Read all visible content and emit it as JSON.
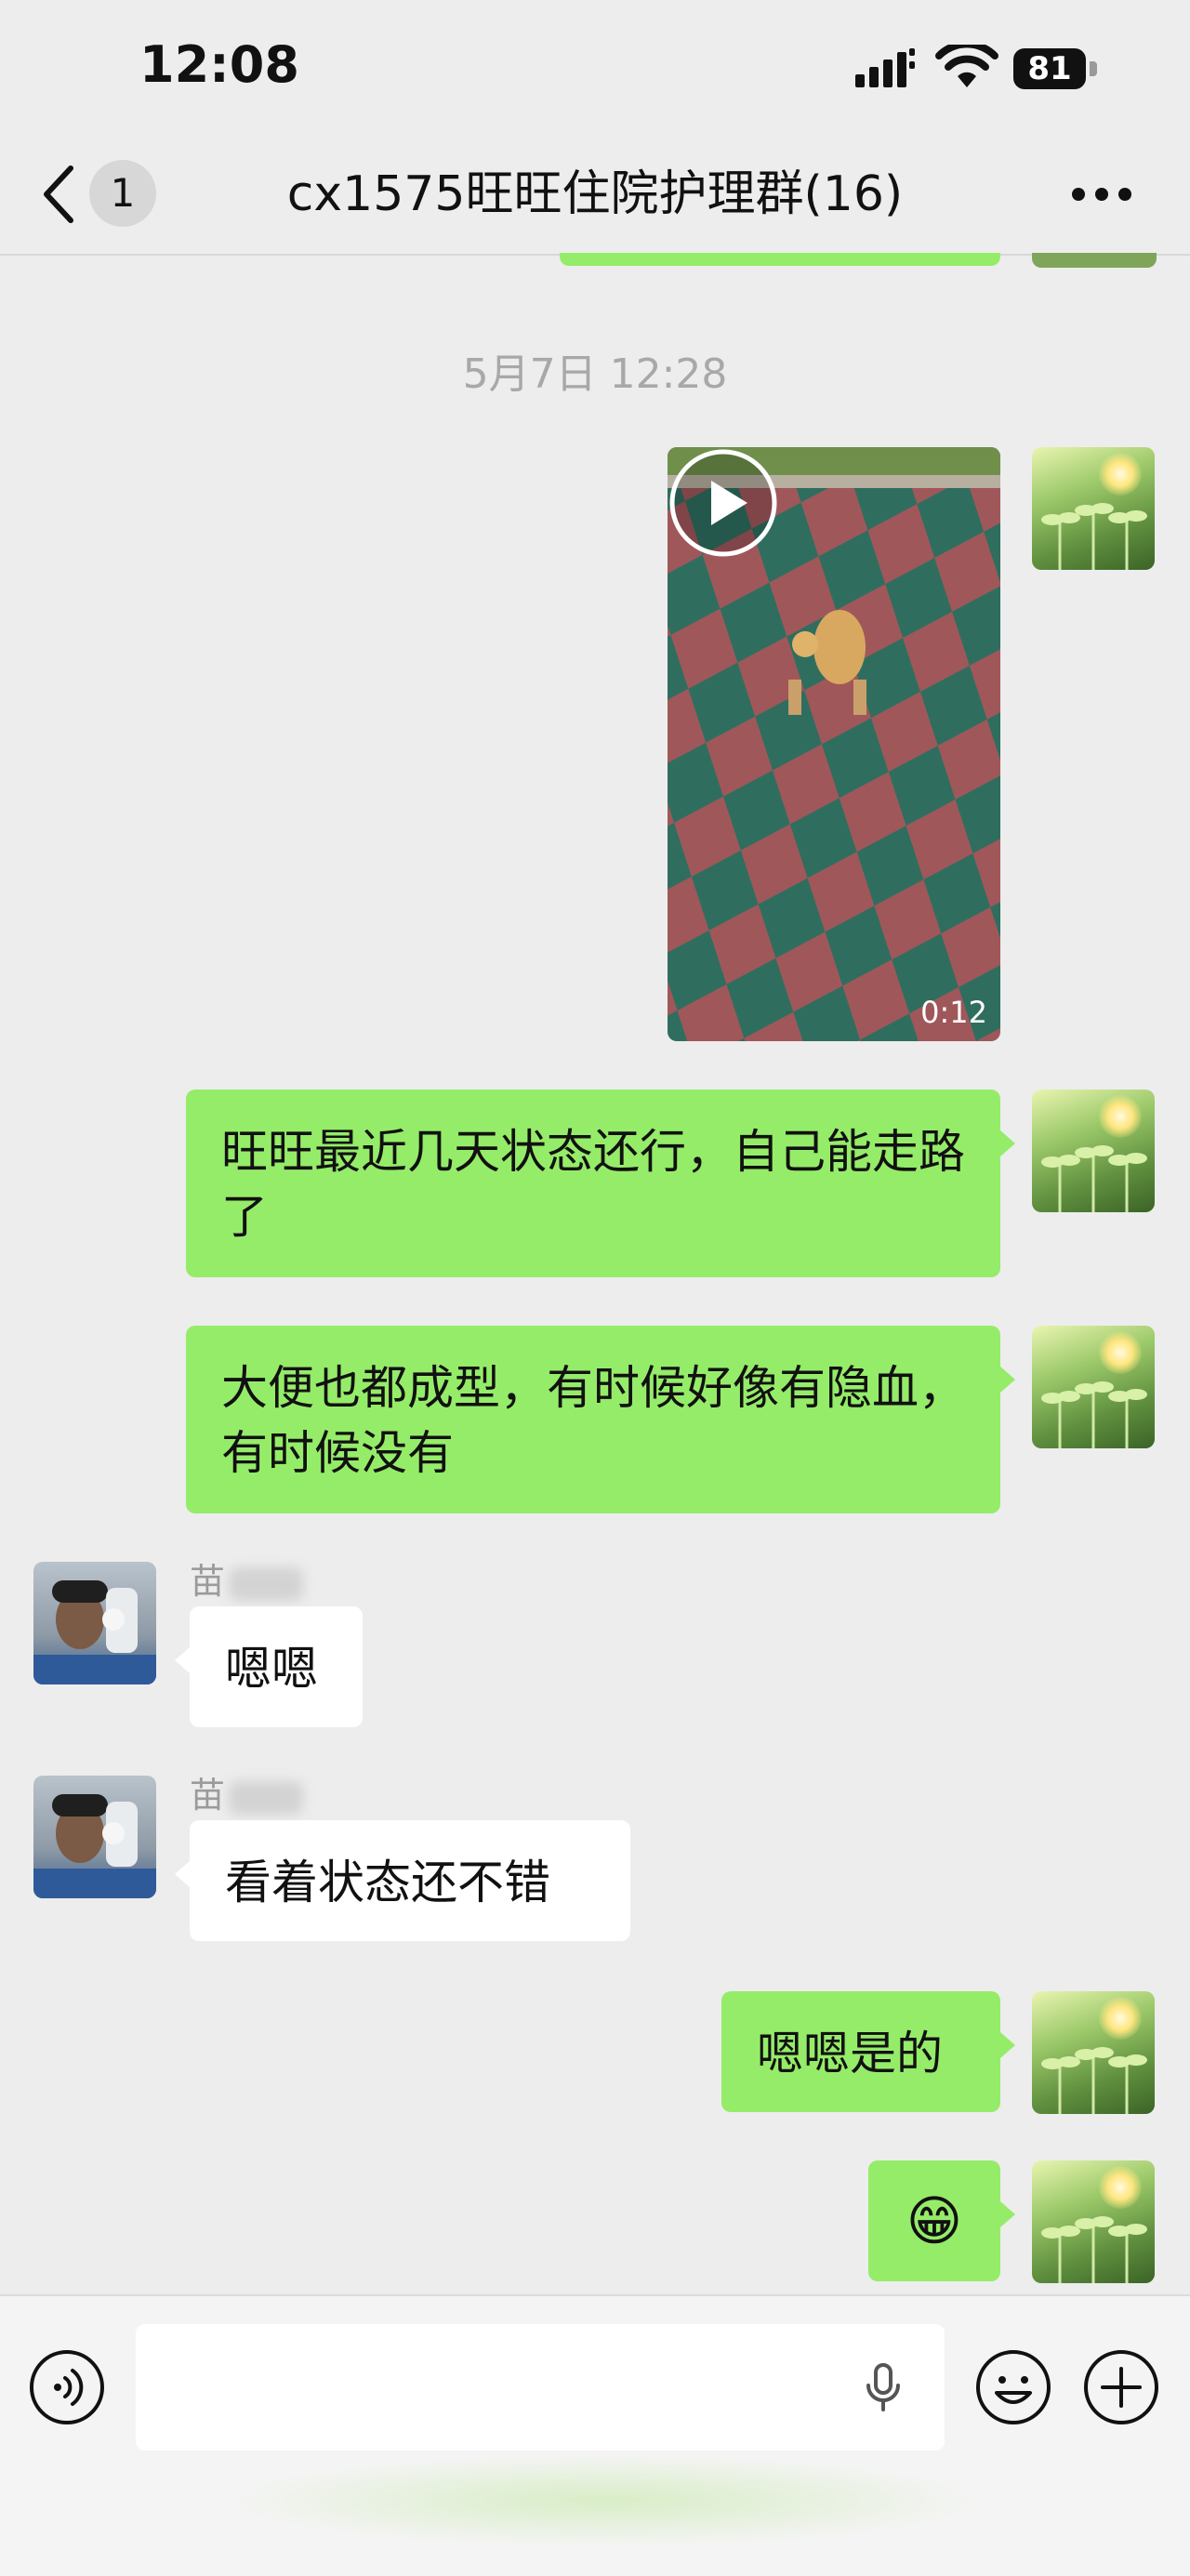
{
  "status_bar": {
    "time": "12:08",
    "battery": "81"
  },
  "nav": {
    "unread_count": "1",
    "title": "cx1575旺旺住院护理群(16)"
  },
  "timestamp": "5月7日 12:28",
  "video": {
    "duration": "0:12"
  },
  "messages": {
    "m1": "旺旺最近几天状态还行，自己能走路了",
    "m2": "大便也都成型，有时候好像有隐血，有时候没有",
    "m3_sender": "苗",
    "m3": "嗯嗯",
    "m4_sender": "苗",
    "m4": "看着状态还不错",
    "m5": "嗯嗯是的",
    "m6": "😁"
  },
  "input": {
    "placeholder": ""
  },
  "colors": {
    "self_bubble": "#95ec69",
    "background": "#ededed",
    "other_bubble": "#ffffff"
  }
}
